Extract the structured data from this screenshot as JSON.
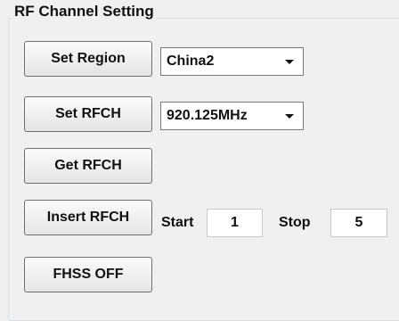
{
  "group": {
    "title": "RF Channel Setting"
  },
  "buttons": {
    "set_region": "Set Region",
    "set_rfch": "Set RFCH",
    "get_rfch": "Get RFCH",
    "insert_rfch": "Insert RFCH",
    "fhss_off": "FHSS OFF"
  },
  "region_select": {
    "value": "China2"
  },
  "frequency_select": {
    "value": "920.125MHz"
  },
  "insert": {
    "start_label": "Start",
    "start_value": "1",
    "stop_label": "Stop",
    "stop_value": "5"
  },
  "icons": {
    "dropdown": "chevron-down-icon"
  }
}
